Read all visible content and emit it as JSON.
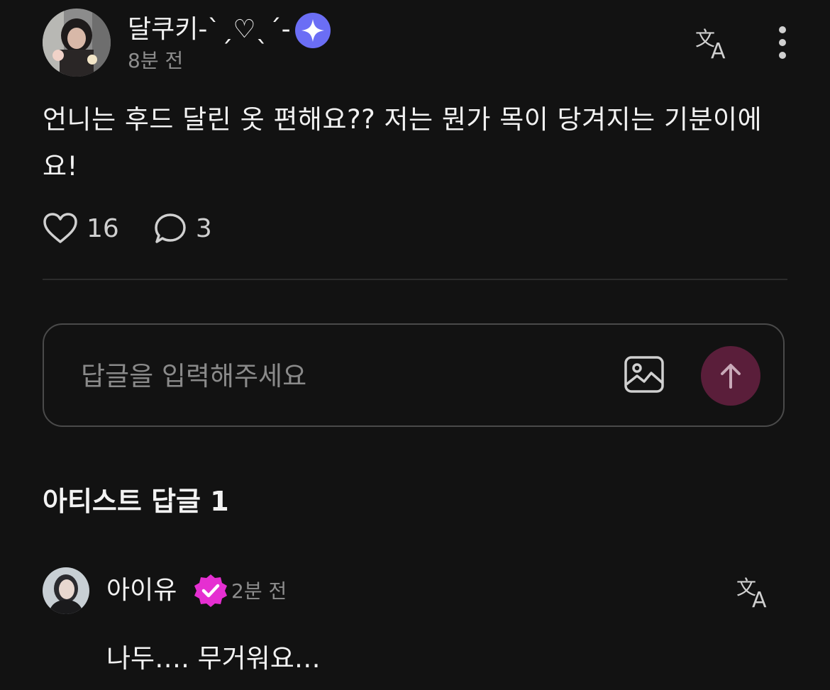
{
  "post": {
    "author": "달쿠키-ˋˏ♡ˎˊ-",
    "author_badge_icon": "sparkle-badge-icon",
    "time": "8분 전",
    "body": "언니는 후드 달린 옷 편해요?? 저는 뭔가 목이 당겨지는 기분이에요!",
    "likes": "16",
    "comments": "3"
  },
  "reply": {
    "placeholder": "답글을 입력해주세요"
  },
  "artist_section": {
    "title": "아티스트 답글 1"
  },
  "artist_comment": {
    "author": "아이유",
    "time": "2분 전",
    "body": "나두…. 무거워요…"
  },
  "colors": {
    "background": "#121212",
    "send_button": "#5a1e3a",
    "plus_badge": "#6b6ef5",
    "verified_badge": "#e52fd1"
  },
  "icons": {
    "translate": "translate-icon",
    "more": "more-vertical-icon",
    "like": "heart-icon",
    "comment": "comment-bubble-icon",
    "image": "image-icon",
    "send": "arrow-up-icon",
    "verified": "verified-check-icon"
  }
}
